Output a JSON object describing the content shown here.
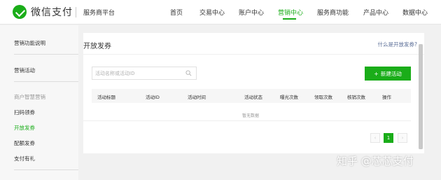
{
  "header": {
    "brand": "微信支付",
    "platform": "服务商平台",
    "nav": [
      {
        "label": "首页"
      },
      {
        "label": "交易中心"
      },
      {
        "label": "账户中心"
      },
      {
        "label": "营销中心",
        "active": true
      },
      {
        "label": "服务商功能"
      },
      {
        "label": "产品中心"
      },
      {
        "label": "数据中心"
      }
    ]
  },
  "sidebar": {
    "items": [
      {
        "label": "营销功能说明"
      },
      {
        "label": "营销活动"
      },
      {
        "label": "商户智慧营销",
        "group": true
      },
      {
        "label": "扫码领券"
      },
      {
        "label": "开放发券",
        "active": true
      },
      {
        "label": "配额发券"
      },
      {
        "label": "支付有礼"
      }
    ]
  },
  "main": {
    "title": "开放发券",
    "help_link": "什么是开放发券?",
    "search_placeholder": "活动名称或活动ID",
    "new_button": "新建活动",
    "table": {
      "headers": [
        "活动标题",
        "活动ID",
        "活动时间",
        "活动状态",
        "曝光次数",
        "领取次数",
        "核销次数",
        "操作"
      ],
      "empty_text": "暂无数据"
    },
    "pagination": {
      "prev": "‹",
      "current": "1",
      "next": "›"
    }
  },
  "watermark": "知乎 @芯芯支付",
  "colors": {
    "accent": "#1aad19",
    "link": "#576b95"
  }
}
